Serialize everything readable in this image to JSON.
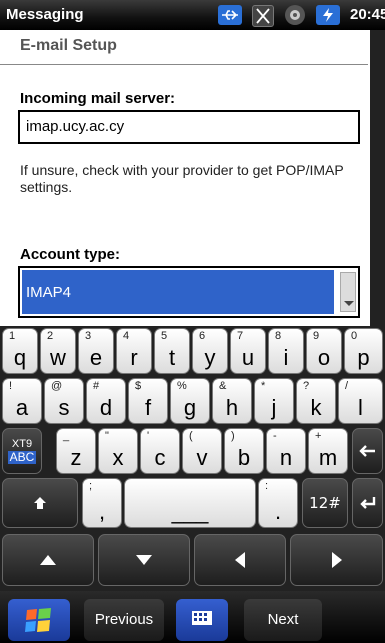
{
  "status_bar": {
    "app_name": "Messaging",
    "time": "20:45",
    "icons": [
      "usb-icon",
      "sim-icon",
      "speaker-icon",
      "battery-charging-icon"
    ]
  },
  "page": {
    "title": "E-mail Setup",
    "incoming_label": "Incoming mail server:",
    "incoming_value": "imap.ucy.ac.cy",
    "hint": "If unsure, check with your provider to get POP/IMAP settings.",
    "account_type_label": "Account type:",
    "account_type_value": "IMAP4"
  },
  "keyboard": {
    "row1": [
      {
        "alt": "1",
        "main": "q"
      },
      {
        "alt": "2",
        "main": "w"
      },
      {
        "alt": "3",
        "main": "e"
      },
      {
        "alt": "4",
        "main": "r"
      },
      {
        "alt": "5",
        "main": "t"
      },
      {
        "alt": "6",
        "main": "y"
      },
      {
        "alt": "7",
        "main": "u"
      },
      {
        "alt": "8",
        "main": "i"
      },
      {
        "alt": "9",
        "main": "o"
      },
      {
        "alt": "0",
        "main": "p"
      }
    ],
    "row2": [
      {
        "alt": "!",
        "main": "a"
      },
      {
        "alt": "@",
        "main": "s"
      },
      {
        "alt": "#",
        "main": "d"
      },
      {
        "alt": "$",
        "main": "f"
      },
      {
        "alt": "%",
        "main": "g"
      },
      {
        "alt": "&",
        "main": "h"
      },
      {
        "alt": "*",
        "main": "j"
      },
      {
        "alt": "?",
        "main": "k"
      },
      {
        "alt": "/",
        "main": "l"
      }
    ],
    "row3": [
      {
        "alt": "_",
        "main": "z"
      },
      {
        "alt": "\"",
        "main": "x"
      },
      {
        "alt": "'",
        "main": "c"
      },
      {
        "alt": "(",
        "main": "v"
      },
      {
        "alt": ")",
        "main": "b"
      },
      {
        "alt": "-",
        "main": "n"
      },
      {
        "alt": "+",
        "main": "m"
      }
    ],
    "xt9_top": "XT9",
    "xt9_bottom": "ABC",
    "semicolon_alt": ";",
    "comma": ",",
    "colon_alt": ":",
    "period": ".",
    "numsym": "12#",
    "space_glyph": "___"
  },
  "softkeys": {
    "left": "Previous",
    "right": "Next"
  }
}
